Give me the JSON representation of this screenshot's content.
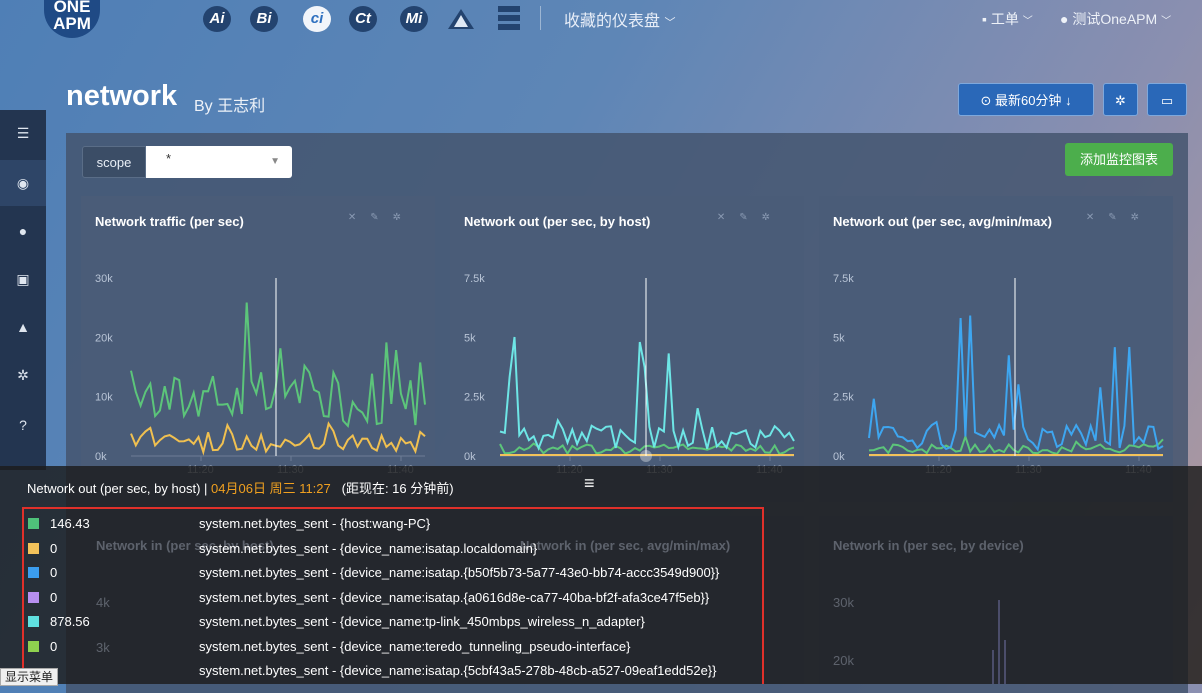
{
  "nav": {
    "logo_text": "ONE APM",
    "apps": [
      "Ai",
      "Bi",
      "ci",
      "Ct",
      "Mi"
    ],
    "dashboards_label": "收藏的仪表盘",
    "ticket_label": "工单",
    "user_label": "测试OneAPM"
  },
  "page": {
    "title": "network",
    "by": "By 王志利"
  },
  "toolbar": {
    "time_label": "最新60分钟"
  },
  "scope": {
    "label": "scope",
    "value": "*"
  },
  "add_chart_label": "添加监控图表",
  "panels": [
    {
      "title": "Network traffic (per sec)",
      "y_ticks": [
        "30k",
        "20k",
        "10k",
        "0k"
      ],
      "x_ticks": [
        "11:20",
        "11:30",
        "11:40"
      ]
    },
    {
      "title": "Network out (per sec, by host)",
      "y_ticks": [
        "7.5k",
        "5k",
        "2.5k",
        "0k"
      ],
      "x_ticks": [
        "11:20",
        "11:30",
        "11:40"
      ]
    },
    {
      "title": "Network out (per sec, avg/min/max)",
      "y_ticks": [
        "7.5k",
        "5k",
        "2.5k",
        "0k"
      ],
      "x_ticks": [
        "11:20",
        "11:30",
        "11:40"
      ]
    }
  ],
  "background_panels": {
    "p1_title": "Network in (per sec, by host)",
    "p2_title": "Network in (per sec, avg/min/max)",
    "p3_title": "Network in (per sec, by device)",
    "p1_tick_a": "4k",
    "p1_tick_b": "3k",
    "p3_tick_a": "30k",
    "p3_tick_b": "20k"
  },
  "tooltip": {
    "title": "Network out (per sec, by host)",
    "separator": "|",
    "datetime": "04月06日 周三 11:27",
    "relative": "(距现在: 16 分钟前)",
    "rows": [
      {
        "value": "146.43",
        "name": "system.net.bytes_sent - {host:wang-PC}",
        "color": "#4fc27a"
      },
      {
        "value": "0",
        "name": "system.net.bytes_sent - {device_name:isatap.localdomain}",
        "color": "#f2c25a"
      },
      {
        "value": "0",
        "name": "system.net.bytes_sent - {device_name:isatap.{b50f5b73-5a77-43e0-bb74-accc3549d900}}",
        "color": "#3b9ef0"
      },
      {
        "value": "0",
        "name": "system.net.bytes_sent - {device_name:isatap.{a0616d8e-ca77-40ba-bf2f-afa3ce47f5eb}}",
        "color": "#b78ff0"
      },
      {
        "value": "878.56",
        "name": "system.net.bytes_sent - {device_name:tp-link_450mbps_wireless_n_adapter}",
        "color": "#5fe0e0"
      },
      {
        "value": "0",
        "name": "system.net.bytes_sent - {device_name:teredo_tunneling_pseudo-interface}",
        "color": "#8fd14f"
      },
      {
        "value": "",
        "name": "system.net.bytes_sent - {device_name:isatap.{5cbf43a5-278b-48cb-a527-09eaf1edd52e}}",
        "color": ""
      }
    ]
  },
  "show_menu_label": "显示菜单",
  "colors": {
    "green": "#5cc57a",
    "yellow": "#f0c050",
    "cyan": "#6ee6e6",
    "blue": "#3ea6f0",
    "red_outline": "#e0302a"
  }
}
